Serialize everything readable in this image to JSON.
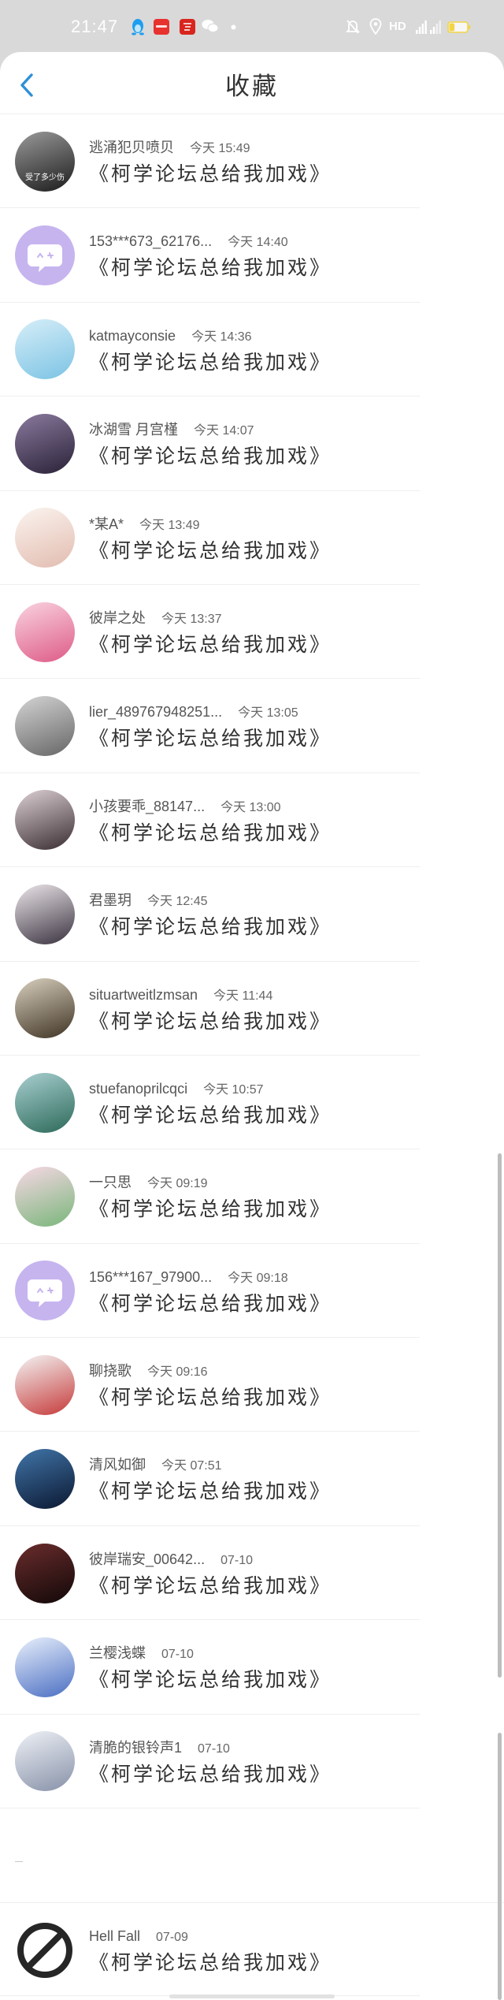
{
  "status_bar": {
    "time": "21:47",
    "network_label": "HD",
    "left_icons": [
      "qq-icon",
      "app-notification-icon",
      "app-notification-icon",
      "wechat-icon",
      "more-dot-icon"
    ],
    "right_icons": [
      "mute-icon",
      "location-icon",
      "signal-icon",
      "signal-icon",
      "battery-icon"
    ],
    "battery_level": 0.3
  },
  "header": {
    "back_icon": "chevron-left-icon",
    "title": "收藏"
  },
  "colors": {
    "accent": "#2f8fd8",
    "status_bar_bg": "#d9d9d9",
    "battery_fill": "#f2d547",
    "text_primary": "#333333",
    "text_secondary": "#666666"
  },
  "favorites": [
    {
      "name": "逃涌犯贝喷贝",
      "time": "今天 15:49",
      "message": "《柯学论坛总给我加戏》",
      "avatar": {
        "kind": "photo",
        "colors": [
          "#9a9a9a",
          "#1c1c1c"
        ],
        "caption": "受了多少伤"
      }
    },
    {
      "name": "153***673_62176...",
      "time": "今天 14:40",
      "message": "《柯学论坛总给我加戏》",
      "avatar": {
        "kind": "default-chat",
        "icon": "chat-bubble-icon"
      }
    },
    {
      "name": "katmayconsie",
      "time": "今天 14:36",
      "message": "《柯学论坛总给我加戏》",
      "avatar": {
        "kind": "photo",
        "colors": [
          "#d6eef8",
          "#7cc3e4"
        ]
      }
    },
    {
      "name": "冰湖雪 月宫槿",
      "time": "今天 14:07",
      "message": "《柯学论坛总给我加戏》",
      "avatar": {
        "kind": "photo",
        "colors": [
          "#8a7a9e",
          "#2a2238"
        ]
      }
    },
    {
      "name": "*某A*",
      "time": "今天 13:49",
      "message": "《柯学论坛总给我加戏》",
      "avatar": {
        "kind": "photo",
        "colors": [
          "#fbf4ef",
          "#e2bcb0"
        ]
      }
    },
    {
      "name": "彼岸之处",
      "time": "今天 13:37",
      "message": "《柯学论坛总给我加戏》",
      "avatar": {
        "kind": "photo",
        "colors": [
          "#f9d3e1",
          "#de5b86"
        ]
      }
    },
    {
      "name": "lier_489767948251...",
      "time": "今天 13:05",
      "message": "《柯学论坛总给我加戏》",
      "avatar": {
        "kind": "photo",
        "colors": [
          "#d4d4d4",
          "#666666"
        ]
      }
    },
    {
      "name": "小孩要乖_88147...",
      "time": "今天 13:00",
      "message": "《柯学论坛总给我加戏》",
      "avatar": {
        "kind": "photo",
        "colors": [
          "#dcd0d4",
          "#3a2d32"
        ]
      }
    },
    {
      "name": "君墨玥",
      "time": "今天 12:45",
      "message": "《柯学论坛总给我加戏》",
      "avatar": {
        "kind": "photo",
        "colors": [
          "#ece6ea",
          "#3a3340"
        ]
      }
    },
    {
      "name": "situartweitlzmsan",
      "time": "今天 11:44",
      "message": "《柯学论坛总给我加戏》",
      "avatar": {
        "kind": "photo",
        "colors": [
          "#d9cfbd",
          "#3f3425"
        ]
      }
    },
    {
      "name": "stuefanoprilcqci",
      "time": "今天 10:57",
      "message": "《柯学论坛总给我加戏》",
      "avatar": {
        "kind": "photo",
        "colors": [
          "#a8cfd0",
          "#2d6a5a"
        ]
      }
    },
    {
      "name": "一只思",
      "time": "今天 09:19",
      "message": "《柯学论坛总给我加戏》",
      "avatar": {
        "kind": "photo",
        "colors": [
          "#f8d8e6",
          "#79b67a"
        ]
      }
    },
    {
      "name": "156***167_97900...",
      "time": "今天 09:18",
      "message": "《柯学论坛总给我加戏》",
      "avatar": {
        "kind": "default-chat",
        "icon": "chat-bubble-icon"
      }
    },
    {
      "name": "聊挠歌",
      "time": "今天 09:16",
      "message": "《柯学论坛总给我加戏》",
      "avatar": {
        "kind": "photo",
        "colors": [
          "#f4f4f4",
          "#c63a3a"
        ]
      }
    },
    {
      "name": "清风如御",
      "time": "今天 07:51",
      "message": "《柯学论坛总给我加戏》",
      "avatar": {
        "kind": "photo",
        "colors": [
          "#4175a8",
          "#0b1832"
        ]
      }
    },
    {
      "name": "彼岸瑞安_00642...",
      "time": "07-10",
      "message": "《柯学论坛总给我加戏》",
      "avatar": {
        "kind": "photo",
        "colors": [
          "#6a2c2c",
          "#120808"
        ]
      }
    },
    {
      "name": "兰樱浅蝶",
      "time": "07-10",
      "message": "《柯学论坛总给我加戏》",
      "avatar": {
        "kind": "photo",
        "colors": [
          "#e9f0fc",
          "#4a6ec2"
        ]
      }
    },
    {
      "name": "清脆的银铃声1",
      "time": "07-10",
      "message": "《柯学论坛总给我加戏》",
      "avatar": {
        "kind": "photo",
        "colors": [
          "#eef1f6",
          "#8791a8"
        ]
      }
    },
    {
      "name": "Hell Fall",
      "time": "07-09",
      "message": "《柯学论坛总给我加戏》",
      "avatar": {
        "kind": "no-entry",
        "icon": "no-entry-icon"
      }
    }
  ]
}
